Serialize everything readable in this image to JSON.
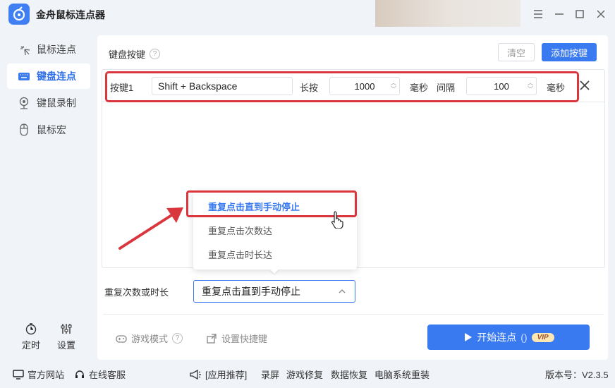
{
  "app": {
    "title": "金舟鼠标连点器"
  },
  "sidebar": {
    "items": [
      {
        "label": "鼠标连点",
        "icon": "mouse-click-icon"
      },
      {
        "label": "键盘连点",
        "icon": "keyboard-icon"
      },
      {
        "label": "键鼠录制",
        "icon": "record-icon"
      },
      {
        "label": "鼠标宏",
        "icon": "mouse-icon"
      }
    ],
    "timer_label": "定时",
    "settings_label": "设置"
  },
  "main": {
    "section_title": "键盘按键",
    "clear_label": "清空",
    "add_label": "添加按键",
    "key_row": {
      "label": "按键1",
      "key_value": "Shift + Backspace",
      "hold_label": "长按",
      "hold_value": "1000",
      "hold_unit": "毫秒",
      "interval_label": "间隔",
      "interval_value": "100",
      "interval_unit": "毫秒"
    },
    "dropdown_options": [
      "重复点击直到手动停止",
      "重复点击次数达",
      "重复点击时长达"
    ],
    "repeat_label": "重复次数或时长",
    "repeat_selected": "重复点击直到手动停止",
    "game_mode_label": "游戏模式",
    "shortcut_label": "设置快捷键",
    "start_label": "开始连点",
    "start_hint": "()",
    "vip_label": "VIP"
  },
  "footer": {
    "official_site": "官方网站",
    "online_service": "在线客服",
    "recommend": "[应用推荐]",
    "links": [
      "录屏",
      "游戏修复",
      "数据恢复",
      "电脑系统重装"
    ],
    "version": "版本号：V2.3.5"
  },
  "colors": {
    "accent": "#3a7af0",
    "highlight": "#d9363e"
  }
}
